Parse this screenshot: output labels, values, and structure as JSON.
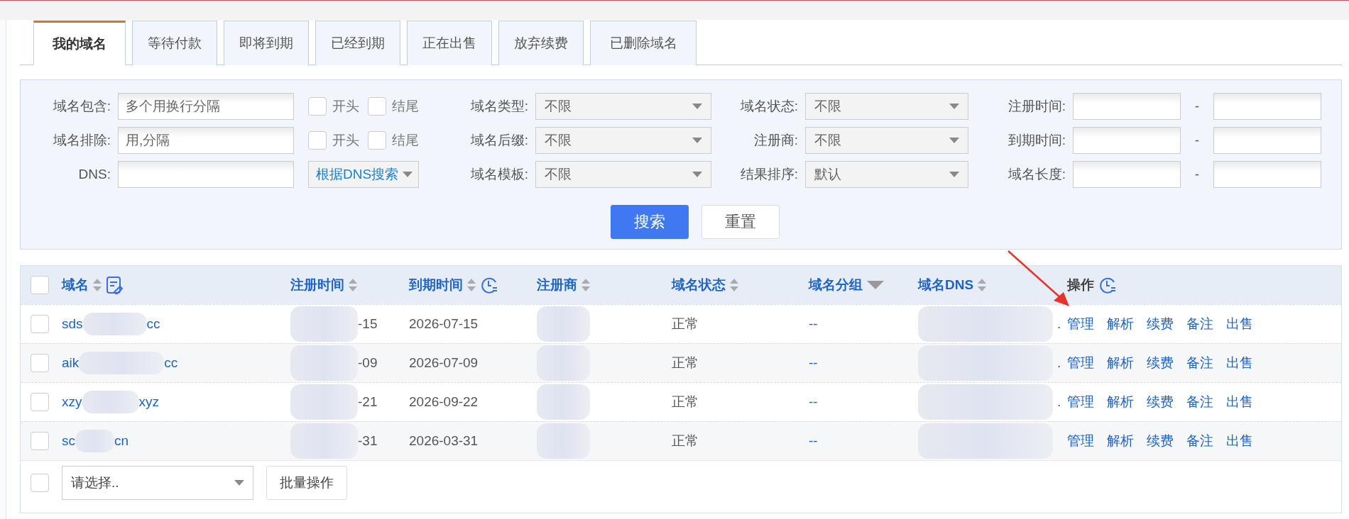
{
  "tabs": [
    {
      "label": "我的域名",
      "selected": true
    },
    {
      "label": "等待付款",
      "selected": false
    },
    {
      "label": "即将到期",
      "selected": false
    },
    {
      "label": "已经到期",
      "selected": false
    },
    {
      "label": "正在出售",
      "selected": false
    },
    {
      "label": "放弃续费",
      "selected": false
    },
    {
      "label": "已删除域名",
      "selected": false
    }
  ],
  "filter_rows": [
    {
      "field": {
        "label": "域名包含:",
        "placeholder": "多个用换行分隔"
      },
      "middle": {
        "kind": "checkboxes",
        "items": [
          {
            "label": "开头",
            "checked": false
          },
          {
            "label": "结尾",
            "checked": false
          }
        ]
      },
      "select_a": {
        "label": "域名类型:",
        "value": "不限"
      },
      "select_b": {
        "label": "域名状态:",
        "value": "不限"
      },
      "range": {
        "label": "注册时间:",
        "separator": "-"
      }
    },
    {
      "field": {
        "label": "域名排除:",
        "placeholder": "用,分隔"
      },
      "middle": {
        "kind": "checkboxes",
        "items": [
          {
            "label": "开头",
            "checked": false
          },
          {
            "label": "结尾",
            "checked": false
          }
        ]
      },
      "select_a": {
        "label": "域名后缀:",
        "value": "不限"
      },
      "select_b": {
        "label": "注册商:",
        "value": "不限"
      },
      "range": {
        "label": "到期时间:",
        "separator": "-"
      }
    },
    {
      "field": {
        "label": "DNS:"
      },
      "middle": {
        "kind": "dropdown",
        "value": "根据DNS搜索"
      },
      "select_a": {
        "label": "域名模板:",
        "value": "不限"
      },
      "select_b": {
        "label": "结果排序:",
        "value": "默认"
      },
      "range": {
        "label": "域名长度:",
        "separator": "-"
      }
    }
  ],
  "filter_buttons": [
    {
      "label": "搜索",
      "kind": "primary"
    },
    {
      "label": "重置",
      "kind": "plain"
    }
  ],
  "table": {
    "header_checked": false,
    "columns": [
      {
        "label": "域名",
        "sortable": true,
        "edit_tool": true
      },
      {
        "label": "注册时间",
        "sortable": true
      },
      {
        "label": "到期时间",
        "sortable": true,
        "time_tool": true
      },
      {
        "label": "注册商",
        "sortable": true
      },
      {
        "label": "域名状态",
        "sortable": true
      },
      {
        "label": "域名分组",
        "sortable": false,
        "filter_menu": true
      },
      {
        "label": "域名DNS",
        "sortable": true
      },
      {
        "label": "操作",
        "sortable": false,
        "time_tool": true
      }
    ],
    "rows": [
      {
        "checked": false,
        "domain_start": "sds",
        "domain_end": "cc",
        "reg_date": "-15",
        "exp_date": "2026-07-15",
        "status": "正常",
        "group": "--",
        "dns": ".",
        "actions": [
          "管理",
          "解析",
          "续费",
          "备注",
          "出售"
        ]
      },
      {
        "checked": false,
        "domain_start": "aik",
        "domain_end": "cc",
        "reg_date": "-09",
        "exp_date": "2026-07-09",
        "status": "正常",
        "group": "--",
        "dns": ".",
        "actions": [
          "管理",
          "解析",
          "续费",
          "备注",
          "出售"
        ]
      },
      {
        "checked": false,
        "domain_start": "xzy",
        "domain_end": "xyz",
        "reg_date": "-21",
        "exp_date": "2026-09-22",
        "status": "正常",
        "group": "--",
        "dns": ".",
        "actions": [
          "管理",
          "解析",
          "续费",
          "备注",
          "出售"
        ]
      },
      {
        "checked": false,
        "domain_start": "sc",
        "domain_end": "cn",
        "reg_date": "-31",
        "exp_date": "2026-03-31",
        "status": "正常",
        "group": "--",
        "actions": [
          "管理",
          "解析",
          "续费",
          "备注",
          "出售"
        ]
      }
    ]
  },
  "bulk": {
    "checked": false,
    "select": "请选择..",
    "button": "批量操作"
  }
}
